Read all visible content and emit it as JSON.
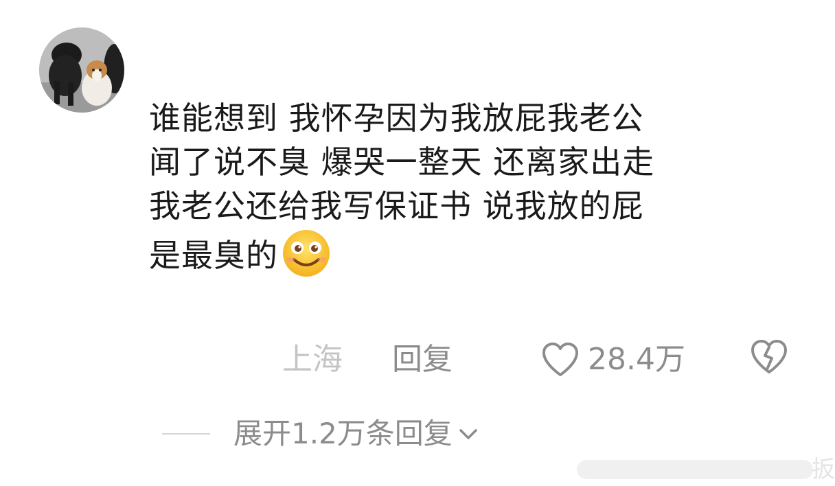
{
  "comment": {
    "lines": [
      "谁能想到 我怀孕因为我放屁我老公",
      "闻了说不臭 爆哭一整天 还离家出走",
      "我老公还给我写保证书 说我放的屁",
      "是最臭的"
    ],
    "emoji": "smiling-face-emoji"
  },
  "meta": {
    "location": "上海",
    "reply_label": "回复",
    "like_count": "28.4万",
    "like_icon": "heart-outline-icon",
    "dislike_icon": "broken-heart-icon"
  },
  "replies": {
    "expand_label": "展开1.2万条回复",
    "expand_icon": "chevron-down-icon"
  },
  "watermark": {
    "text": "扳"
  },
  "colors": {
    "text_primary": "#1a1a1a",
    "text_secondary": "#8c8c8c",
    "text_tertiary": "#c4c4c4",
    "emoji_fill": "#ffcc33"
  }
}
